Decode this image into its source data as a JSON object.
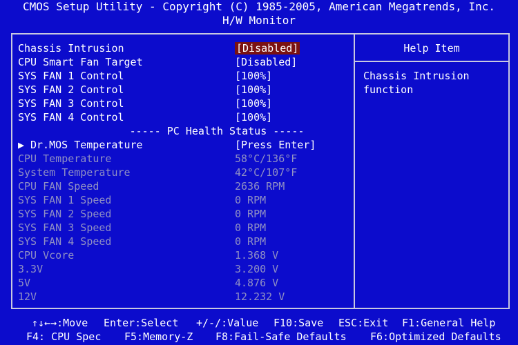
{
  "header": {
    "title": "CMOS Setup Utility - Copyright (C) 1985-2005, American Megatrends, Inc.",
    "subtitle": "H/W Monitor"
  },
  "settings": {
    "chassis_intrusion": {
      "label": "Chassis Intrusion",
      "value": "[Disabled]"
    },
    "cpu_smart_fan": {
      "label": "CPU Smart Fan Target",
      "value": "[Disabled]"
    },
    "sys_fan1": {
      "label": "SYS FAN 1 Control",
      "value": "[100%]"
    },
    "sys_fan2": {
      "label": "SYS FAN 2 Control",
      "value": "[100%]"
    },
    "sys_fan3": {
      "label": "SYS FAN 3 Control",
      "value": "[100%]"
    },
    "sys_fan4": {
      "label": "SYS FAN 4 Control",
      "value": "[100%]"
    },
    "section_title": "----- PC Health Status -----",
    "drmos": {
      "label": "Dr.MOS Temperature",
      "value": "[Press Enter]",
      "arrow": "▶"
    },
    "cpu_temp": {
      "label": "CPU Temperature",
      "value": "58°C/136°F"
    },
    "sys_temp": {
      "label": "System Temperature",
      "value": "42°C/107°F"
    },
    "cpu_fan_speed": {
      "label": "CPU FAN Speed",
      "value": "2636 RPM"
    },
    "sys_fan1_speed": {
      "label": "SYS FAN 1 Speed",
      "value": "0 RPM"
    },
    "sys_fan2_speed": {
      "label": "SYS FAN 2 Speed",
      "value": "0 RPM"
    },
    "sys_fan3_speed": {
      "label": "SYS FAN 3 Speed",
      "value": "0 RPM"
    },
    "sys_fan4_speed": {
      "label": "SYS FAN 4 Speed",
      "value": "0 RPM"
    },
    "cpu_vcore": {
      "label": "CPU Vcore",
      "value": "1.368 V"
    },
    "v33": {
      "label": "3.3V",
      "value": "3.200 V"
    },
    "v5": {
      "label": "5V",
      "value": "4.876 V"
    },
    "v12": {
      "label": "12V",
      "value": "12.232 V"
    }
  },
  "help": {
    "title": "Help Item",
    "text_line1": "Chassis Intrusion",
    "text_line2": "function"
  },
  "footer": {
    "row1": {
      "move": "↑↓←→:Move",
      "enter": "Enter:Select",
      "value": "+/-/:Value",
      "save": "F10:Save",
      "exit": "ESC:Exit",
      "help": "F1:General Help"
    },
    "row2": {
      "cpu_spec": "F4: CPU Spec",
      "memory_z": "F5:Memory-Z",
      "failsafe": "F8:Fail-Safe Defaults",
      "optimized": "F6:Optimized Defaults"
    }
  },
  "colors": {
    "background": "#0c0ccc",
    "selection": "#7a1212",
    "dim_text": "#9090c4"
  }
}
